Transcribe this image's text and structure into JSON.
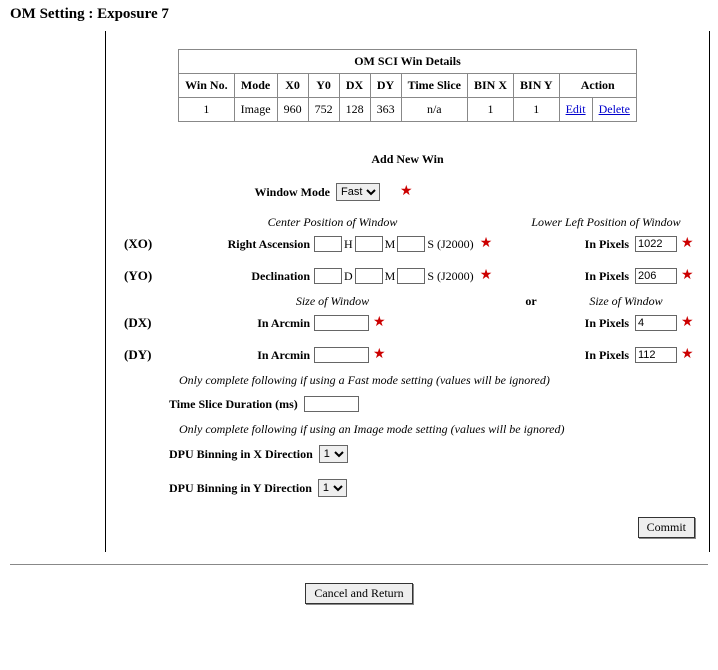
{
  "page_title": "OM Setting : Exposure 7",
  "table": {
    "caption": "OM SCI Win Details",
    "headers": [
      "Win No.",
      "Mode",
      "X0",
      "Y0",
      "DX",
      "DY",
      "Time Slice",
      "BIN X",
      "BIN Y",
      "Action"
    ],
    "row": {
      "win_no": "1",
      "mode": "Image",
      "x0": "960",
      "y0": "752",
      "dx": "128",
      "dy": "363",
      "time_slice": "n/a",
      "bin_x": "1",
      "bin_y": "1",
      "edit": "Edit",
      "delete": "Delete"
    }
  },
  "add_new_title": "Add New Win",
  "window_mode": {
    "label": "Window Mode",
    "value": "Fast"
  },
  "center_heading": "Center Position of Window",
  "lower_left_heading": "Lower Left Position of Window",
  "xo": {
    "tag": "(XO)",
    "label": "Right Ascension",
    "h": "",
    "m": "",
    "s": "",
    "unit_h": "H",
    "unit_m": "M",
    "unit_s": "S (J2000)",
    "px_label": "In Pixels",
    "px": "1022"
  },
  "yo": {
    "tag": "(YO)",
    "label": "Declination",
    "d": "",
    "m": "",
    "s": "",
    "unit_d": "D",
    "unit_m": "M",
    "unit_s": "S (J2000)",
    "px_label": "In Pixels",
    "px": "206"
  },
  "size_heading": "Size of Window",
  "or_text": "or",
  "dx": {
    "tag": "(DX)",
    "label": "In Arcmin",
    "val": "",
    "px_label": "In Pixels",
    "px": "4"
  },
  "dy": {
    "tag": "(DY)",
    "label": "In Arcmin",
    "val": "",
    "px_label": "In Pixels",
    "px": "112"
  },
  "note_fast": "Only complete following if using a Fast mode setting (values will be ignored)",
  "time_slice": {
    "label": "Time Slice Duration (ms)",
    "val": ""
  },
  "note_image": "Only complete following if using an Image mode setting (values will be ignored)",
  "dpu_x": {
    "label": "DPU Binning in X Direction",
    "val": "1"
  },
  "dpu_y": {
    "label": "DPU Binning in Y Direction",
    "val": "1"
  },
  "commit": "Commit",
  "cancel": "Cancel and Return"
}
